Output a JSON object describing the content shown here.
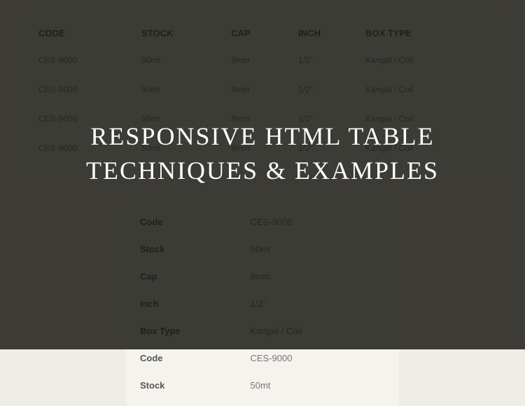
{
  "overlay": {
    "title_line1": "RESPONSIVE HTML TABLE",
    "title_line2": "TECHNIQUES & EXAMPLES"
  },
  "wide_table": {
    "headers": {
      "code": "CODE",
      "stock": "STOCK",
      "cap": "CAP",
      "inch": "INCH",
      "box_type": "BOX TYPE"
    },
    "rows": [
      {
        "code": "CES-9000",
        "stock": "50mt",
        "cap": "9mm",
        "inch": "1/2\"",
        "box_type": "Kangal / Coil"
      },
      {
        "code": "CES-9000",
        "stock": "50mt",
        "cap": "9mm",
        "inch": "1/2\"",
        "box_type": "Kangal / Coil"
      },
      {
        "code": "CES-9000",
        "stock": "50mt",
        "cap": "9mm",
        "inch": "1/2\"",
        "box_type": "Kangal / Coil"
      },
      {
        "code": "CES-9000",
        "stock": "50mt",
        "cap": "9mm",
        "inch": "1/2\"",
        "box_type": "Kangal / Coil"
      }
    ]
  },
  "narrow_table": {
    "items": [
      {
        "label": "Code",
        "value": "CES-9000"
      },
      {
        "label": "Stock",
        "value": "50mt"
      },
      {
        "label": "Cap",
        "value": "9mm"
      },
      {
        "label": "Inch",
        "value": "1/2\""
      },
      {
        "label": "Box Type",
        "value": "Kangal / Coil"
      },
      {
        "label": "Code",
        "value": "CES-9000"
      },
      {
        "label": "Stock",
        "value": "50mt"
      }
    ]
  }
}
